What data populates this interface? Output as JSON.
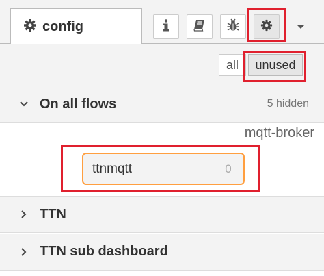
{
  "tabs": {
    "active_label": "config",
    "active_icon": "gear-icon",
    "buttons": [
      {
        "name": "info-icon",
        "glyph": "i"
      },
      {
        "name": "help-book-icon",
        "glyph": "book"
      },
      {
        "name": "debug-bug-icon",
        "glyph": "bug"
      },
      {
        "name": "config-gear-icon",
        "glyph": "gear"
      }
    ],
    "dropdown_icon": "caret-down-icon"
  },
  "filter": {
    "all_label": "all",
    "unused_label": "unused",
    "selected": "unused"
  },
  "sections": [
    {
      "title": "On all flows",
      "expanded": true,
      "meta": "5 hidden",
      "groups": [
        {
          "type_label": "mqtt-broker",
          "nodes": [
            {
              "label": "ttnmqtt",
              "count": "0"
            }
          ]
        }
      ]
    },
    {
      "title": "TTN",
      "expanded": false
    },
    {
      "title": "TTN sub dashboard",
      "expanded": false
    }
  ],
  "colors": {
    "highlight": "#e0202e",
    "node_border": "#ff9f40",
    "panel_bg": "#f3f3f3"
  }
}
